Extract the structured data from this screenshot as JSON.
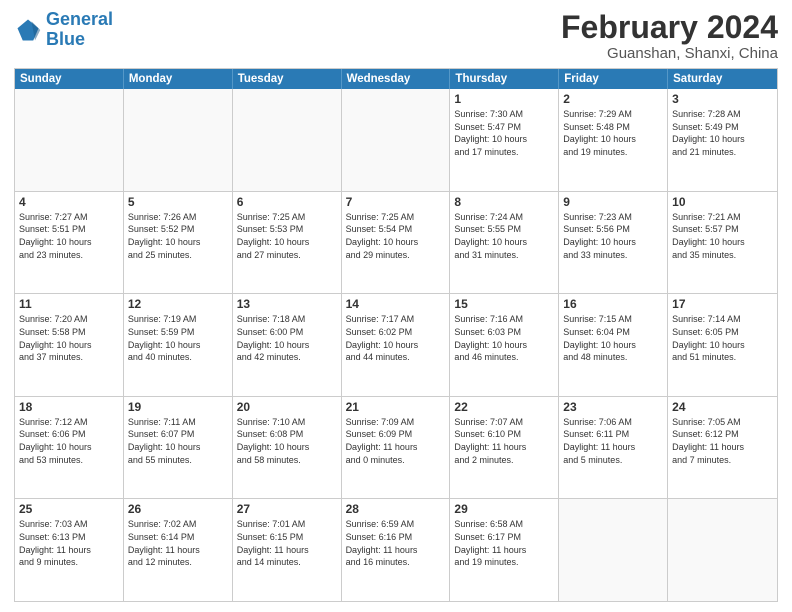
{
  "header": {
    "logo_line1": "General",
    "logo_line2": "Blue",
    "title": "February 2024",
    "subtitle": "Guanshan, Shanxi, China"
  },
  "days_of_week": [
    "Sunday",
    "Monday",
    "Tuesday",
    "Wednesday",
    "Thursday",
    "Friday",
    "Saturday"
  ],
  "weeks": [
    [
      {
        "day": "",
        "info": ""
      },
      {
        "day": "",
        "info": ""
      },
      {
        "day": "",
        "info": ""
      },
      {
        "day": "",
        "info": ""
      },
      {
        "day": "1",
        "info": "Sunrise: 7:30 AM\nSunset: 5:47 PM\nDaylight: 10 hours\nand 17 minutes."
      },
      {
        "day": "2",
        "info": "Sunrise: 7:29 AM\nSunset: 5:48 PM\nDaylight: 10 hours\nand 19 minutes."
      },
      {
        "day": "3",
        "info": "Sunrise: 7:28 AM\nSunset: 5:49 PM\nDaylight: 10 hours\nand 21 minutes."
      }
    ],
    [
      {
        "day": "4",
        "info": "Sunrise: 7:27 AM\nSunset: 5:51 PM\nDaylight: 10 hours\nand 23 minutes."
      },
      {
        "day": "5",
        "info": "Sunrise: 7:26 AM\nSunset: 5:52 PM\nDaylight: 10 hours\nand 25 minutes."
      },
      {
        "day": "6",
        "info": "Sunrise: 7:25 AM\nSunset: 5:53 PM\nDaylight: 10 hours\nand 27 minutes."
      },
      {
        "day": "7",
        "info": "Sunrise: 7:25 AM\nSunset: 5:54 PM\nDaylight: 10 hours\nand 29 minutes."
      },
      {
        "day": "8",
        "info": "Sunrise: 7:24 AM\nSunset: 5:55 PM\nDaylight: 10 hours\nand 31 minutes."
      },
      {
        "day": "9",
        "info": "Sunrise: 7:23 AM\nSunset: 5:56 PM\nDaylight: 10 hours\nand 33 minutes."
      },
      {
        "day": "10",
        "info": "Sunrise: 7:21 AM\nSunset: 5:57 PM\nDaylight: 10 hours\nand 35 minutes."
      }
    ],
    [
      {
        "day": "11",
        "info": "Sunrise: 7:20 AM\nSunset: 5:58 PM\nDaylight: 10 hours\nand 37 minutes."
      },
      {
        "day": "12",
        "info": "Sunrise: 7:19 AM\nSunset: 5:59 PM\nDaylight: 10 hours\nand 40 minutes."
      },
      {
        "day": "13",
        "info": "Sunrise: 7:18 AM\nSunset: 6:00 PM\nDaylight: 10 hours\nand 42 minutes."
      },
      {
        "day": "14",
        "info": "Sunrise: 7:17 AM\nSunset: 6:02 PM\nDaylight: 10 hours\nand 44 minutes."
      },
      {
        "day": "15",
        "info": "Sunrise: 7:16 AM\nSunset: 6:03 PM\nDaylight: 10 hours\nand 46 minutes."
      },
      {
        "day": "16",
        "info": "Sunrise: 7:15 AM\nSunset: 6:04 PM\nDaylight: 10 hours\nand 48 minutes."
      },
      {
        "day": "17",
        "info": "Sunrise: 7:14 AM\nSunset: 6:05 PM\nDaylight: 10 hours\nand 51 minutes."
      }
    ],
    [
      {
        "day": "18",
        "info": "Sunrise: 7:12 AM\nSunset: 6:06 PM\nDaylight: 10 hours\nand 53 minutes."
      },
      {
        "day": "19",
        "info": "Sunrise: 7:11 AM\nSunset: 6:07 PM\nDaylight: 10 hours\nand 55 minutes."
      },
      {
        "day": "20",
        "info": "Sunrise: 7:10 AM\nSunset: 6:08 PM\nDaylight: 10 hours\nand 58 minutes."
      },
      {
        "day": "21",
        "info": "Sunrise: 7:09 AM\nSunset: 6:09 PM\nDaylight: 11 hours\nand 0 minutes."
      },
      {
        "day": "22",
        "info": "Sunrise: 7:07 AM\nSunset: 6:10 PM\nDaylight: 11 hours\nand 2 minutes."
      },
      {
        "day": "23",
        "info": "Sunrise: 7:06 AM\nSunset: 6:11 PM\nDaylight: 11 hours\nand 5 minutes."
      },
      {
        "day": "24",
        "info": "Sunrise: 7:05 AM\nSunset: 6:12 PM\nDaylight: 11 hours\nand 7 minutes."
      }
    ],
    [
      {
        "day": "25",
        "info": "Sunrise: 7:03 AM\nSunset: 6:13 PM\nDaylight: 11 hours\nand 9 minutes."
      },
      {
        "day": "26",
        "info": "Sunrise: 7:02 AM\nSunset: 6:14 PM\nDaylight: 11 hours\nand 12 minutes."
      },
      {
        "day": "27",
        "info": "Sunrise: 7:01 AM\nSunset: 6:15 PM\nDaylight: 11 hours\nand 14 minutes."
      },
      {
        "day": "28",
        "info": "Sunrise: 6:59 AM\nSunset: 6:16 PM\nDaylight: 11 hours\nand 16 minutes."
      },
      {
        "day": "29",
        "info": "Sunrise: 6:58 AM\nSunset: 6:17 PM\nDaylight: 11 hours\nand 19 minutes."
      },
      {
        "day": "",
        "info": ""
      },
      {
        "day": "",
        "info": ""
      }
    ]
  ]
}
